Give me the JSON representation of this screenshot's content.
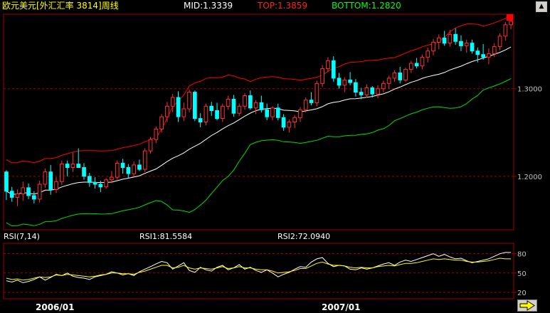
{
  "header": {
    "title": "欧元美元[外汇汇率 3814]周线",
    "mid": "MID:1.3339",
    "top": "TOP:1.3859",
    "bottom": "BOTTOM:1.2820"
  },
  "rsi_header": {
    "name": "RSI(7,14)",
    "rsi1": "RSI1:81.5584",
    "rsi2": "RSI2:72.0940"
  },
  "nav": {
    "scroll_up": "▲",
    "next": "⇨"
  },
  "colors": {
    "up": "#ff3030",
    "down": "#00ffff",
    "upper_band": "#ff0000",
    "mid_band": "#ffffff",
    "lower_band": "#00dd00",
    "rsi1": "#ffffff",
    "rsi2": "#ffff00",
    "grid": "#a00000"
  },
  "chart_data": [
    {
      "type": "candlestick",
      "title": "欧元美元[外汇汇率 3814]周线",
      "x_labels": [
        "2006/01",
        "2007/01"
      ],
      "y_ticks": [
        "1.3000",
        "1.2000"
      ],
      "ylim": [
        1.139,
        1.385
      ],
      "band_params": {
        "period": 20,
        "width": 2.0
      },
      "overlays": [
        "upper_band",
        "mid_band",
        "lower_band"
      ],
      "bars": [
        [
          1.205,
          1.207,
          1.173,
          1.183
        ],
        [
          1.183,
          1.188,
          1.171,
          1.176
        ],
        [
          1.176,
          1.185,
          1.166,
          1.18
        ],
        [
          1.18,
          1.194,
          1.172,
          1.187
        ],
        [
          1.187,
          1.192,
          1.174,
          1.178
        ],
        [
          1.178,
          1.183,
          1.169,
          1.174
        ],
        [
          1.174,
          1.195,
          1.17,
          1.191
        ],
        [
          1.191,
          1.209,
          1.187,
          1.205
        ],
        [
          1.205,
          1.213,
          1.179,
          1.185
        ],
        [
          1.185,
          1.199,
          1.181,
          1.194
        ],
        [
          1.194,
          1.218,
          1.19,
          1.214
        ],
        [
          1.214,
          1.218,
          1.2,
          1.21
        ],
        [
          1.21,
          1.227,
          1.205,
          1.214
        ],
        [
          1.214,
          1.232,
          1.21,
          1.21
        ],
        [
          1.21,
          1.215,
          1.196,
          1.2
        ],
        [
          1.2,
          1.204,
          1.188,
          1.193
        ],
        [
          1.193,
          1.199,
          1.186,
          1.191
        ],
        [
          1.191,
          1.195,
          1.182,
          1.188
        ],
        [
          1.188,
          1.198,
          1.186,
          1.196
        ],
        [
          1.196,
          1.206,
          1.192,
          1.199
        ],
        [
          1.199,
          1.218,
          1.196,
          1.215
        ],
        [
          1.215,
          1.22,
          1.203,
          1.21
        ],
        [
          1.21,
          1.214,
          1.198,
          1.203
        ],
        [
          1.203,
          1.217,
          1.2,
          1.213
        ],
        [
          1.213,
          1.219,
          1.206,
          1.208
        ],
        [
          1.208,
          1.232,
          1.205,
          1.229
        ],
        [
          1.229,
          1.245,
          1.226,
          1.242
        ],
        [
          1.242,
          1.257,
          1.238,
          1.254
        ],
        [
          1.254,
          1.271,
          1.25,
          1.268
        ],
        [
          1.268,
          1.285,
          1.262,
          1.28
        ],
        [
          1.28,
          1.294,
          1.273,
          1.29
        ],
        [
          1.29,
          1.297,
          1.262,
          1.268
        ],
        [
          1.268,
          1.284,
          1.263,
          1.277
        ],
        [
          1.277,
          1.299,
          1.273,
          1.296
        ],
        [
          1.296,
          1.298,
          1.263,
          1.266
        ],
        [
          1.266,
          1.272,
          1.256,
          1.262
        ],
        [
          1.262,
          1.283,
          1.258,
          1.28
        ],
        [
          1.28,
          1.285,
          1.269,
          1.275
        ],
        [
          1.275,
          1.284,
          1.264,
          1.266
        ],
        [
          1.266,
          1.283,
          1.262,
          1.28
        ],
        [
          1.28,
          1.292,
          1.276,
          1.288
        ],
        [
          1.288,
          1.293,
          1.268,
          1.272
        ],
        [
          1.272,
          1.283,
          1.269,
          1.28
        ],
        [
          1.28,
          1.295,
          1.276,
          1.292
        ],
        [
          1.292,
          1.298,
          1.276,
          1.278
        ],
        [
          1.278,
          1.287,
          1.271,
          1.284
        ],
        [
          1.284,
          1.292,
          1.273,
          1.276
        ],
        [
          1.276,
          1.283,
          1.264,
          1.268
        ],
        [
          1.268,
          1.28,
          1.264,
          1.278
        ],
        [
          1.278,
          1.283,
          1.264,
          1.267
        ],
        [
          1.267,
          1.271,
          1.252,
          1.256
        ],
        [
          1.256,
          1.265,
          1.25,
          1.262
        ],
        [
          1.262,
          1.27,
          1.255,
          1.267
        ],
        [
          1.267,
          1.279,
          1.262,
          1.276
        ],
        [
          1.276,
          1.29,
          1.273,
          1.287
        ],
        [
          1.287,
          1.296,
          1.281,
          1.284
        ],
        [
          1.284,
          1.309,
          1.28,
          1.306
        ],
        [
          1.306,
          1.327,
          1.302,
          1.323
        ],
        [
          1.323,
          1.336,
          1.319,
          1.332
        ],
        [
          1.332,
          1.337,
          1.308,
          1.312
        ],
        [
          1.312,
          1.318,
          1.3,
          1.304
        ],
        [
          1.304,
          1.313,
          1.296,
          1.31
        ],
        [
          1.31,
          1.319,
          1.304,
          1.307
        ],
        [
          1.307,
          1.311,
          1.291,
          1.296
        ],
        [
          1.296,
          1.301,
          1.288,
          1.293
        ],
        [
          1.293,
          1.305,
          1.29,
          1.301
        ],
        [
          1.301,
          1.303,
          1.29,
          1.294
        ],
        [
          1.294,
          1.304,
          1.289,
          1.3
        ],
        [
          1.3,
          1.309,
          1.296,
          1.306
        ],
        [
          1.306,
          1.315,
          1.3,
          1.312
        ],
        [
          1.312,
          1.321,
          1.308,
          1.318
        ],
        [
          1.318,
          1.325,
          1.306,
          1.31
        ],
        [
          1.31,
          1.324,
          1.308,
          1.322
        ],
        [
          1.322,
          1.332,
          1.318,
          1.329
        ],
        [
          1.329,
          1.335,
          1.323,
          1.326
        ],
        [
          1.326,
          1.339,
          1.322,
          1.336
        ],
        [
          1.336,
          1.347,
          1.33,
          1.343
        ],
        [
          1.343,
          1.357,
          1.338,
          1.353
        ],
        [
          1.353,
          1.362,
          1.345,
          1.358
        ],
        [
          1.358,
          1.366,
          1.349,
          1.352
        ],
        [
          1.352,
          1.367,
          1.348,
          1.362
        ],
        [
          1.362,
          1.369,
          1.35,
          1.354
        ],
        [
          1.354,
          1.361,
          1.343,
          1.349
        ],
        [
          1.349,
          1.356,
          1.341,
          1.352
        ],
        [
          1.352,
          1.356,
          1.34,
          1.343
        ],
        [
          1.343,
          1.347,
          1.33,
          1.339
        ],
        [
          1.339,
          1.351,
          1.333,
          1.336
        ],
        [
          1.336,
          1.346,
          1.328,
          1.34
        ],
        [
          1.34,
          1.352,
          1.336,
          1.348
        ],
        [
          1.348,
          1.363,
          1.344,
          1.36
        ],
        [
          1.36,
          1.376,
          1.355,
          1.373
        ],
        [
          1.373,
          1.381,
          1.368,
          1.377
        ]
      ]
    },
    {
      "type": "line",
      "title": "RSI(7,14)",
      "y_ticks": [
        "80",
        "50",
        "20"
      ],
      "ylim": [
        10,
        94
      ],
      "series": [
        {
          "name": "RSI1",
          "values": [
            38,
            36,
            39,
            35,
            37,
            40,
            44,
            39,
            43,
            48,
            46,
            50,
            45,
            43,
            42,
            40,
            44,
            46,
            48,
            52,
            50,
            47,
            49,
            46,
            52,
            56,
            60,
            64,
            68,
            66,
            56,
            61,
            66,
            54,
            51,
            59,
            55,
            53,
            59,
            62,
            55,
            58,
            63,
            56,
            59,
            54,
            51,
            55,
            50,
            44,
            48,
            51,
            56,
            60,
            59,
            67,
            72,
            74,
            65,
            60,
            62,
            61,
            56,
            55,
            58,
            56,
            58,
            61,
            64,
            66,
            62,
            67,
            70,
            68,
            71,
            74,
            77,
            80,
            76,
            79,
            75,
            72,
            73,
            69,
            66,
            68,
            70,
            72,
            76,
            80,
            82,
            82
          ]
        },
        {
          "name": "RSI2",
          "values": [
            42,
            40,
            41,
            39,
            40,
            42,
            44,
            43,
            44,
            47,
            46,
            48,
            47,
            46,
            45,
            44,
            45,
            47,
            48,
            50,
            50,
            49,
            49,
            48,
            51,
            53,
            56,
            59,
            62,
            62,
            58,
            59,
            62,
            58,
            56,
            58,
            57,
            56,
            58,
            60,
            57,
            58,
            60,
            58,
            58,
            56,
            55,
            55,
            53,
            50,
            51,
            52,
            54,
            57,
            57,
            61,
            65,
            67,
            64,
            62,
            62,
            61,
            59,
            58,
            59,
            58,
            58,
            60,
            61,
            62,
            61,
            63,
            65,
            65,
            66,
            68,
            70,
            72,
            71,
            72,
            71,
            70,
            70,
            68,
            67,
            67,
            68,
            69,
            71,
            73,
            72,
            72
          ]
        }
      ]
    }
  ]
}
